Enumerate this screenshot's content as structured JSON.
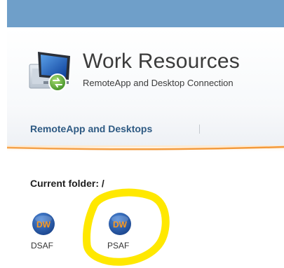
{
  "header": {
    "title": "Work Resources",
    "subtitle": "RemoteApp and Desktop Connection",
    "app_icon": "remote-desktop-icon"
  },
  "nav": {
    "tabs": [
      {
        "label": "RemoteApp and Desktops"
      }
    ]
  },
  "folder": {
    "label": "Current folder: /"
  },
  "resources": [
    {
      "label": "DSAF",
      "icon": "dw-app-icon",
      "icon_text": "DW"
    },
    {
      "label": "PSAF",
      "icon": "dw-app-icon",
      "icon_text": "DW"
    }
  ],
  "colors": {
    "top_bar": "#6f9fc9",
    "nav_text": "#2e5a83",
    "accent_orange": "#f39a3c",
    "highlight": "#ffe800",
    "dw_blue": "#1d4f9a",
    "dw_text": "#ff9a1f"
  }
}
